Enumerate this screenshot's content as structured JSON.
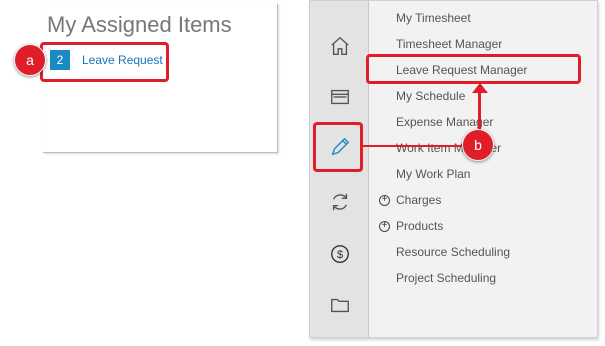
{
  "assigned": {
    "title": "My Assigned Items",
    "item": {
      "count": "2",
      "label": "Leave Request"
    }
  },
  "callouts": {
    "a": "a",
    "b": "b"
  },
  "menu": {
    "items": [
      {
        "label": "My Timesheet",
        "expandable": false
      },
      {
        "label": "Timesheet Manager",
        "expandable": false
      },
      {
        "label": "Leave Request Manager",
        "expandable": false
      },
      {
        "label": "My Schedule",
        "expandable": false
      },
      {
        "label": "Expense Manager",
        "expandable": false
      },
      {
        "label": "Work Item Manager",
        "expandable": false
      },
      {
        "label": "My Work Plan",
        "expandable": false
      },
      {
        "label": "Charges",
        "expandable": true
      },
      {
        "label": "Products",
        "expandable": true
      },
      {
        "label": "Resource Scheduling",
        "expandable": false
      },
      {
        "label": "Project Scheduling",
        "expandable": false
      }
    ]
  },
  "iconbar": [
    "home-icon",
    "window-icon",
    "pencil-icon",
    "refresh-icon",
    "dollar-icon",
    "folder-icon"
  ],
  "colors": {
    "highlight": "#e01e2a",
    "badge": "#1a8ac6",
    "link": "#1a73b8"
  }
}
